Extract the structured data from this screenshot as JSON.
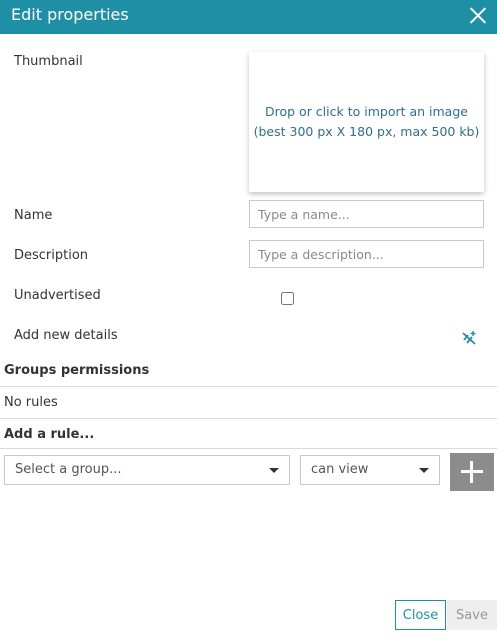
{
  "header": {
    "title": "Edit properties"
  },
  "form": {
    "thumbnail_label": "Thumbnail",
    "thumbnail_line1": "Drop or click to import an image",
    "thumbnail_line2": "(best 300 px X 180 px, max 500 kb)",
    "name_label": "Name",
    "name_placeholder": "Type a name...",
    "name_value": "",
    "description_label": "Description",
    "description_placeholder": "Type a description...",
    "description_value": "",
    "unadvertised_label": "Unadvertised",
    "unadvertised_checked": false,
    "add_details_label": "Add new details",
    "add_details_icon": "add-field-icon"
  },
  "permissions": {
    "title": "Groups permissions",
    "empty_text": "No rules",
    "add_rule_title": "Add a rule...",
    "group_select": "Select a group...",
    "permission_select": "can view"
  },
  "footer": {
    "close_label": "Close",
    "save_label": "Save"
  },
  "colors": {
    "accent": "#1f8fa6",
    "link": "#2f6e96",
    "disabled_button": "#8c8c8c"
  }
}
